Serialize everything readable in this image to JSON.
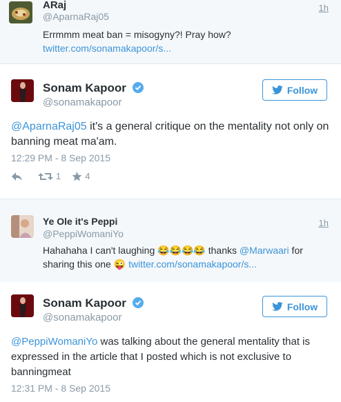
{
  "quoted_tweet": {
    "name": "ARaj",
    "handle": "@AparnaRaj05",
    "time": "1h",
    "text": "Errmmm meat ban = misogyny?! Pray how?",
    "link": "twitter.com/sonamakapoor/s..."
  },
  "tweet1": {
    "name": "Sonam Kapoor",
    "handle": "@sonamakapoor",
    "follow_label": "Follow",
    "mention": "@AparnaRaj05",
    "text": " it's a general critique on the mentality not only on banning meat ma'am.",
    "timestamp": "12:29 PM - 8 Sep 2015",
    "retweet_count": "1",
    "favorite_count": "4"
  },
  "reply_tweet": {
    "name": "Ye Ole it's Peppi",
    "handle": "@PeppiWomaniYo",
    "time": "1h",
    "text_a": "Hahahaha I can't laughing 😂😂😂😂 thanks ",
    "mention": "@Marwaari",
    "text_b": " for sharing this one 😜 ",
    "link": "twitter.com/sonamakapoor/s..."
  },
  "tweet2": {
    "name": "Sonam Kapoor",
    "handle": "@sonamakapoor",
    "follow_label": "Follow",
    "mention": "@PeppiWomaniYo",
    "text": " was talking about the general mentality that is expressed in the article that I posted which is not exclusive to banningmeat",
    "timestamp": "12:31 PM - 8 Sep 2015"
  },
  "colors": {
    "link": "#3b94d9",
    "muted": "#8899a6",
    "text": "#292f33",
    "verified": "#55acee"
  },
  "icons": [
    "reply-icon",
    "retweet-icon",
    "favorite-icon",
    "verified-icon",
    "twitter-bird-icon"
  ]
}
